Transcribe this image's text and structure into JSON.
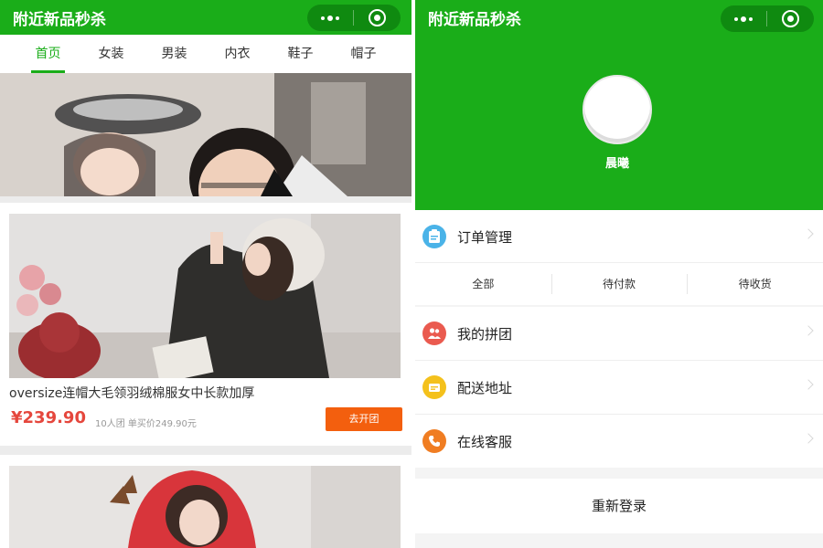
{
  "left_screen": {
    "title": "附近新品秒杀",
    "tabs": [
      {
        "label": "首页",
        "active": true
      },
      {
        "label": "女装",
        "active": false
      },
      {
        "label": "男装",
        "active": false
      },
      {
        "label": "内衣",
        "active": false
      },
      {
        "label": "鞋子",
        "active": false
      },
      {
        "label": "帽子",
        "active": false
      }
    ],
    "products": [
      {
        "title": "oversize连帽大毛领羽绒棉服女中长款加厚",
        "price": "¥239.90",
        "meta": "10人团 单买价249.90元",
        "button": "去开团"
      }
    ]
  },
  "right_screen": {
    "title": "附近新品秒杀",
    "nickname": "晨曦",
    "menu": {
      "orders": "订单管理",
      "order_tabs": [
        "全部",
        "待付款",
        "待收货"
      ],
      "group": "我的拼团",
      "address": "配送地址",
      "service": "在线客服",
      "relogin": "重新登录"
    }
  },
  "colors": {
    "brand_green": "#1aad19",
    "price_red": "#e5473d",
    "button_orange": "#f35f0e"
  },
  "icons": {
    "more": "more-dots-icon",
    "close": "target-circle-icon",
    "orders": "order-clipboard-icon",
    "group": "group-people-icon",
    "address": "address-pin-icon",
    "service": "phone-icon"
  }
}
